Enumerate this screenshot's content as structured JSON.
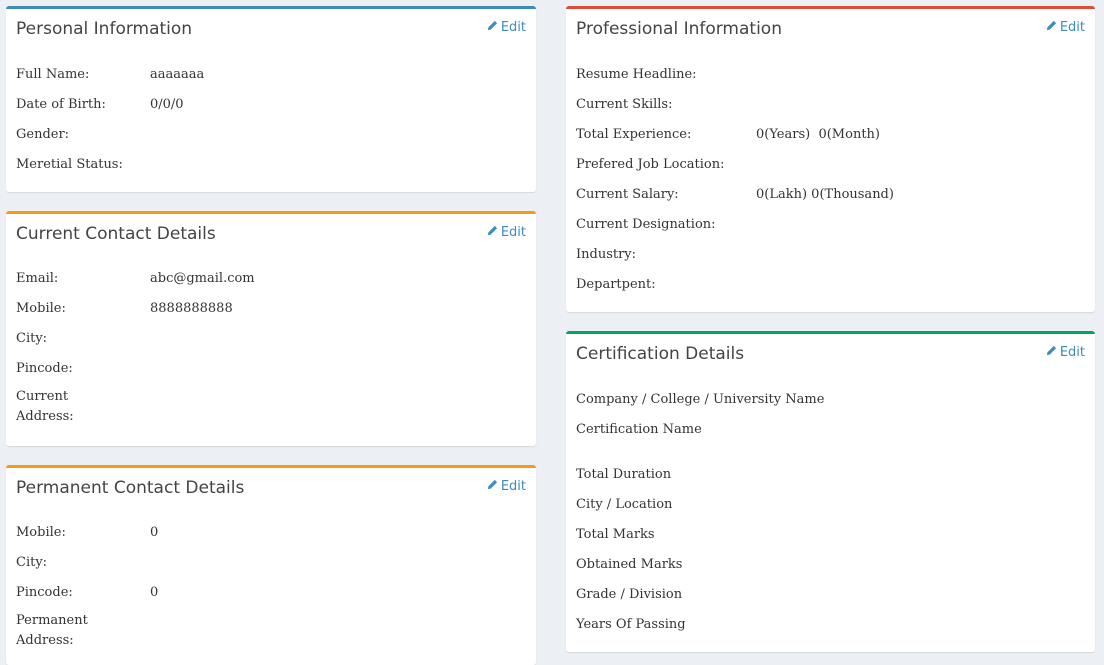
{
  "edit_label": "Edit",
  "personal": {
    "title": "Personal Information",
    "rows": [
      {
        "label": "Full Name:",
        "value": "aaaaaaa"
      },
      {
        "label": "Date of Birth:",
        "value": "0/0/0"
      },
      {
        "label": "Gender:",
        "value": ""
      },
      {
        "label": "Meretial Status:",
        "value": ""
      }
    ]
  },
  "current_contact": {
    "title": "Current Contact Details",
    "rows": [
      {
        "label": "Email:",
        "value": "abc@gmail.com"
      },
      {
        "label": "Mobile:",
        "value": "8888888888"
      },
      {
        "label": "City:",
        "value": ""
      },
      {
        "label": "Pincode:",
        "value": ""
      },
      {
        "label": "Current Address:",
        "value": ""
      }
    ]
  },
  "permanent_contact": {
    "title": "Permanent Contact Details",
    "rows": [
      {
        "label": "Mobile:",
        "value": "0"
      },
      {
        "label": "City:",
        "value": ""
      },
      {
        "label": "Pincode:",
        "value": "0"
      },
      {
        "label": "Permanent Address:",
        "value": ""
      }
    ]
  },
  "professional": {
    "title": "Professional Information",
    "rows": [
      {
        "label": "Resume Headline:",
        "value": ""
      },
      {
        "label": "Current Skills:",
        "value": ""
      },
      {
        "label": "Total Experience:",
        "value": "0(Years)  0(Month)"
      },
      {
        "label": "Prefered Job Location:",
        "value": ""
      },
      {
        "label": "Current Salary:",
        "value": "0(Lakh) 0(Thousand)"
      },
      {
        "label": "Current Designation:",
        "value": ""
      },
      {
        "label": "Industry:",
        "value": ""
      },
      {
        "label": "Departpent:",
        "value": ""
      }
    ]
  },
  "certification": {
    "title": "Certification Details",
    "rows": [
      {
        "label": "Company / College / University Name"
      },
      {
        "label": "Certification Name"
      },
      {
        "label": "Total Duration"
      },
      {
        "label": "City / Location"
      },
      {
        "label": "Total Marks"
      },
      {
        "label": "Obtained Marks"
      },
      {
        "label": "Grade / Division"
      },
      {
        "label": "Years Of Passing"
      }
    ]
  }
}
